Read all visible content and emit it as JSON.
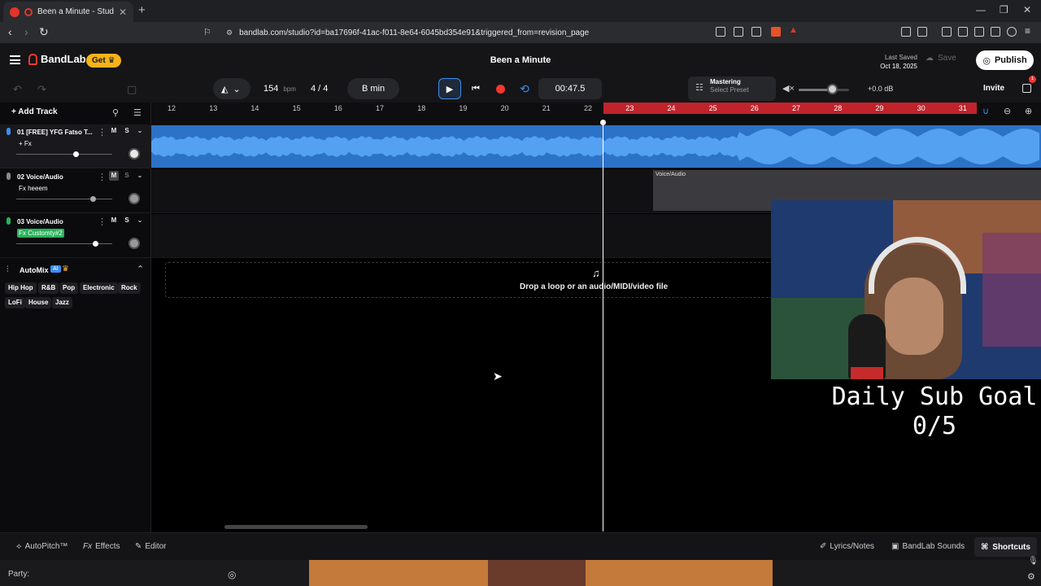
{
  "browser": {
    "tab_title": "Been a Minute - Studio",
    "url": "bandlab.com/studio?id=ba17696f-41ac-f011-8e64-6045bd354e91&triggered_from=revision_page"
  },
  "app": {
    "brand": "BandLab",
    "get_label": "Get",
    "project_title": "Been a Minute",
    "last_saved_label": "Last Saved",
    "last_saved_date": "Oct 18, 2025",
    "save_label": "Save",
    "publish_label": "Publish"
  },
  "transport": {
    "bpm": "154",
    "bpm_unit": "bpm",
    "time_sig": "4 / 4",
    "key": "B min",
    "time": "00:47.5",
    "mastering_label": "Mastering",
    "mastering_preset": "Select Preset",
    "volume_db": "+0.0 dB",
    "volume_level_pct": 68,
    "invite_label": "Invite",
    "gift_badge": "1"
  },
  "left": {
    "add_track": "Add Track",
    "tracks": [
      {
        "name": "01  [FREE] YFG Fatso T...",
        "fx": "+ Fx",
        "color": "#3b8ff0",
        "volume_pct": 62
      },
      {
        "name": "02  Voice/Audio",
        "fx": "Fx heeem",
        "color": "#888888",
        "volume_pct": 80
      },
      {
        "name": "03  Voice/Audio",
        "fx": "Fx Customty#2",
        "color": "#27b35a",
        "volume_pct": 82
      }
    ],
    "track_buttons": {
      "mute": "M",
      "solo": "S"
    },
    "automix_title": "AutoMix",
    "automix_badge": "AI",
    "genres_row1": [
      "Hip Hop",
      "R&B",
      "Pop",
      "Electronic",
      "Rock"
    ],
    "genres_row2": [
      "LoFi",
      "House",
      "Jazz"
    ]
  },
  "ruler": {
    "bars": [
      "12",
      "13",
      "14",
      "15",
      "16",
      "17",
      "18",
      "19",
      "20",
      "21",
      "22",
      "23",
      "24",
      "25",
      "26",
      "27",
      "28",
      "29",
      "30",
      "31"
    ]
  },
  "arrange": {
    "clip2_label": "Voice/Audio",
    "drop_text": "Drop a loop or an audio/MIDI/video file"
  },
  "overlay": {
    "sub_goal_line1": "Daily Sub Goal",
    "sub_goal_line2": "0/5"
  },
  "bottom": {
    "autopitch": "AutoPitch™",
    "effects": "Effects",
    "editor": "Editor",
    "lyrics": "Lyrics/Notes",
    "sounds": "BandLab Sounds",
    "shortcuts": "Shortcuts"
  },
  "chat": {
    "party": "Party:"
  },
  "colors": {
    "accent": "#3b8ff0",
    "record": "#f2372e",
    "loop_region": "#c1232b",
    "clip_blue": "#2c72c7",
    "get_badge": "#f5b21b"
  }
}
